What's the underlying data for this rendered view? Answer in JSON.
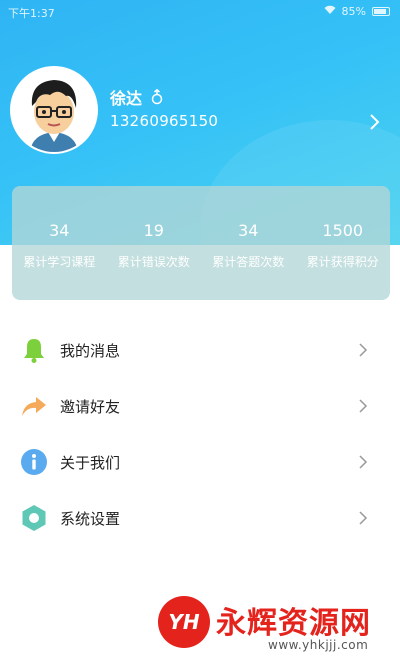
{
  "status_bar": {
    "time": "下午1:37",
    "battery": "85%"
  },
  "profile": {
    "name": "徐达",
    "gender_icon": "male-icon",
    "phone": "13260965150"
  },
  "stats": [
    {
      "value": "34",
      "label": "累计学习课程"
    },
    {
      "value": "19",
      "label": "累计错误次数"
    },
    {
      "value": "34",
      "label": "累计答题次数"
    },
    {
      "value": "1500",
      "label": "累计获得积分"
    }
  ],
  "menu": [
    {
      "label": "我的消息",
      "icon": "bell-icon",
      "color": "#7bd03c"
    },
    {
      "label": "邀请好友",
      "icon": "share-arrow-icon",
      "color": "#f5a95a"
    },
    {
      "label": "关于我们",
      "icon": "info-icon",
      "color": "#5aaaf0"
    },
    {
      "label": "系统设置",
      "icon": "settings-hexagon-icon",
      "color": "#5fc7b5"
    }
  ],
  "watermark": {
    "logo": "YH",
    "title": "永辉资源网",
    "url": "www.yhkjjj.com"
  },
  "colors": {
    "header_gradient_start": "#2fb4f3",
    "header_gradient_end": "#4ad2ee",
    "watermark_red": "#e5231d"
  }
}
